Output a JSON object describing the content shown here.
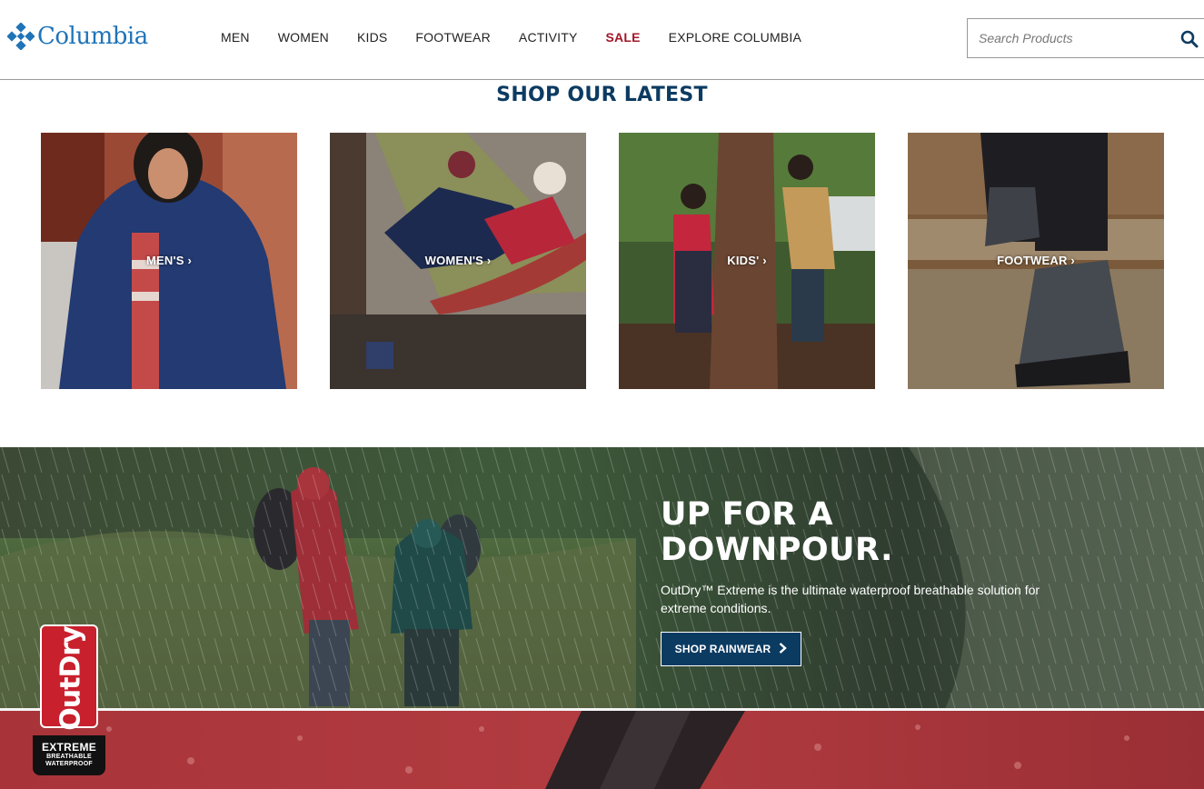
{
  "header": {
    "logo_text": "Columbia",
    "nav": [
      "MEN",
      "WOMEN",
      "KIDS",
      "FOOTWEAR",
      "ACTIVITY",
      "SALE",
      "EXPLORE COLUMBIA"
    ],
    "search_placeholder": "Search Products"
  },
  "latest": {
    "title": "SHOP OUR LATEST",
    "tiles": [
      {
        "label": "MEN'S ›"
      },
      {
        "label": "WOMEN'S ›"
      },
      {
        "label": "KIDS' ›"
      },
      {
        "label": "FOOTWEAR ›"
      }
    ]
  },
  "hero": {
    "heading_line1": "UP FOR A",
    "heading_line2": "DOWNPOUR.",
    "body": "OutDry™ Extreme is the ultimate waterproof breathable solution for extreme conditions.",
    "button_label": "SHOP RAINWEAR",
    "button_icon": "chevron-right-icon"
  },
  "badge": {
    "word": "OutDry",
    "line1": "EXTREME",
    "line2": "BREATHABLE",
    "line3": "WATERPROOF"
  },
  "colors": {
    "brand_blue": "#1f74b8",
    "navy": "#0c3b62",
    "sale_red": "#a2172a",
    "badge_red": "#c8202d"
  }
}
